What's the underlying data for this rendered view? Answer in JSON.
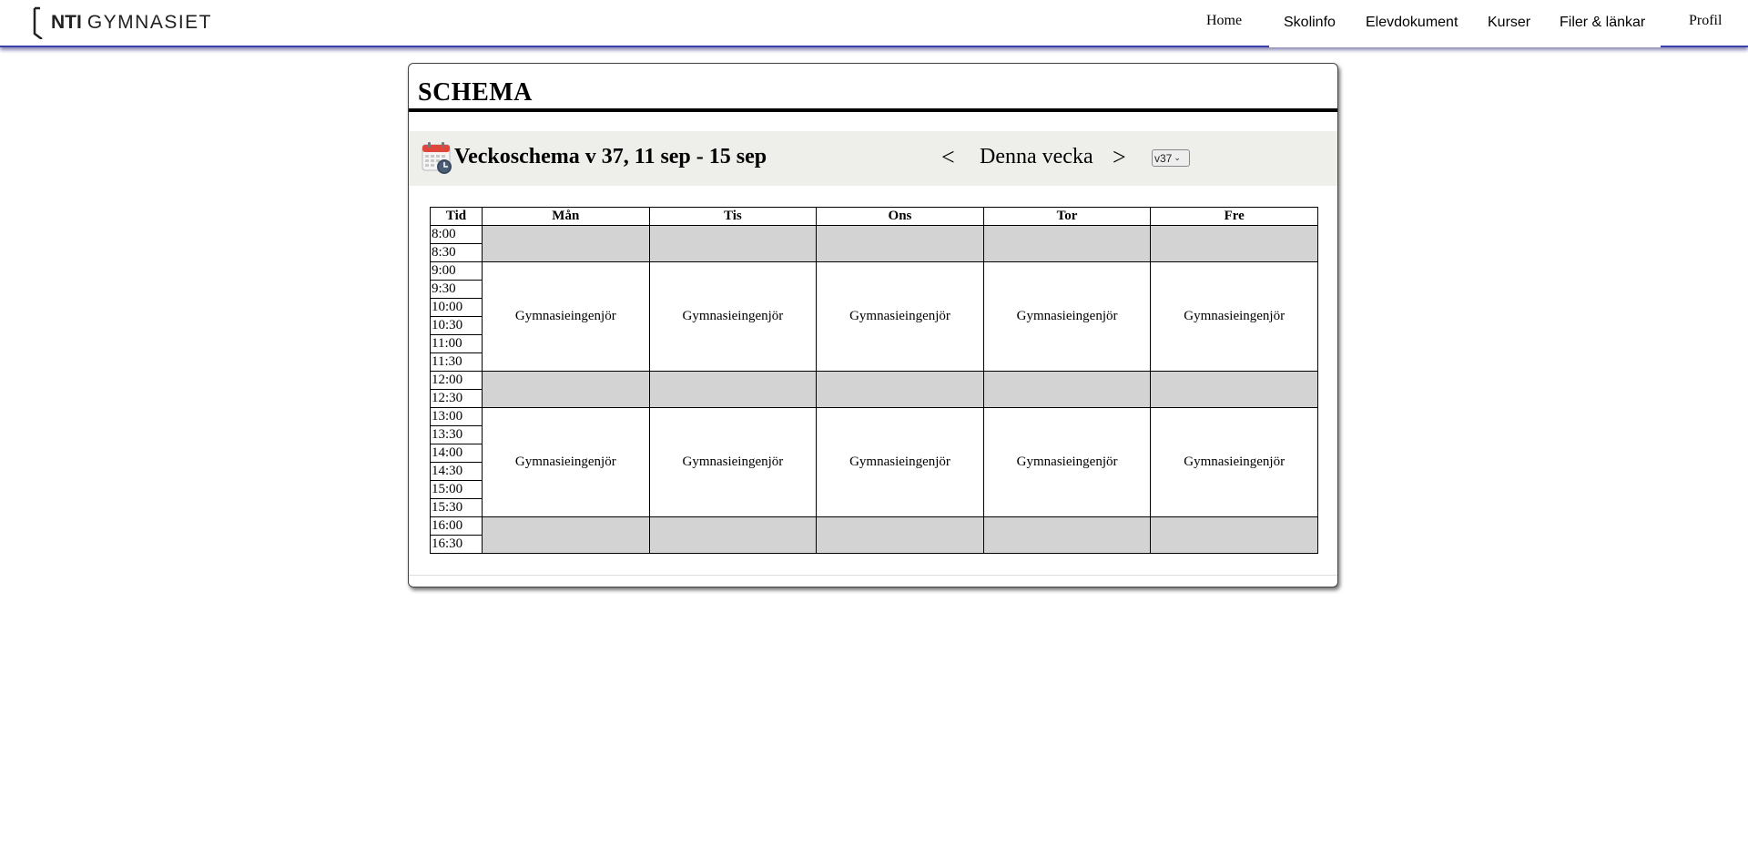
{
  "header": {
    "logo_nti": "NTI",
    "logo_gym": "GYMNASIET",
    "home_label": "Home",
    "nav_items": [
      "Skolinfo",
      "Elevdokument",
      "Kurser",
      "Filer & länkar"
    ],
    "profile_label": "Profil"
  },
  "schema": {
    "title": "SCHEMA",
    "week_title": "Veckoschema v 37, 11 sep - 15 sep",
    "prev_label": "<",
    "current_label": "Denna vecka",
    "next_label": ">",
    "week_select_value": "v37"
  },
  "table": {
    "time_header": "Tid",
    "days": [
      "Mån",
      "Tis",
      "Ons",
      "Tor",
      "Fre"
    ],
    "times": [
      "8:00",
      "8:30",
      "9:00",
      "9:30",
      "10:00",
      "10:30",
      "11:00",
      "11:30",
      "12:00",
      "12:30",
      "13:00",
      "13:30",
      "14:00",
      "14:30",
      "15:00",
      "15:30",
      "16:00",
      "16:30"
    ],
    "blocks": [
      {
        "type": "free",
        "rows": 2,
        "label": ""
      },
      {
        "type": "lesson",
        "rows": 6,
        "label": "Gymnasieingenjör"
      },
      {
        "type": "free",
        "rows": 2,
        "label": ""
      },
      {
        "type": "lesson",
        "rows": 6,
        "label": "Gymnasieingenjör"
      },
      {
        "type": "free",
        "rows": 2,
        "label": ""
      }
    ]
  },
  "colors": {
    "free_slot": "#d3d3d3",
    "week_bar": "#eeeeea",
    "nav_underline": "#3b3fa8"
  }
}
